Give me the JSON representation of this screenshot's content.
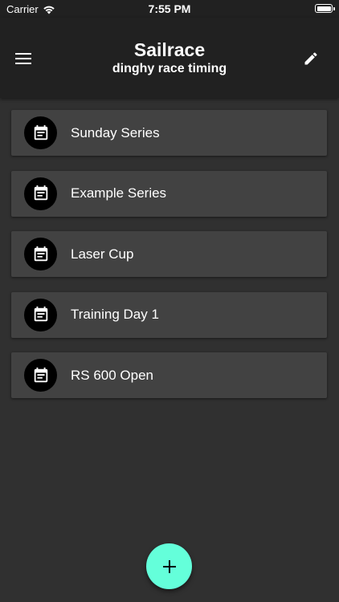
{
  "status_bar": {
    "carrier": "Carrier",
    "time": "7:55 PM"
  },
  "app_bar": {
    "title": "Sailrace",
    "subtitle": "dinghy race timing",
    "menu_icon": "menu-icon",
    "edit_icon": "pencil-icon"
  },
  "series": [
    {
      "label": "Sunday Series",
      "icon": "calendar-note-icon"
    },
    {
      "label": "Example Series",
      "icon": "calendar-note-icon"
    },
    {
      "label": "Laser Cup",
      "icon": "calendar-note-icon"
    },
    {
      "label": "Training Day 1",
      "icon": "calendar-note-icon"
    },
    {
      "label": "RS 600 Open",
      "icon": "calendar-note-icon"
    }
  ],
  "fab": {
    "icon": "plus-icon",
    "color": "#64ffda"
  },
  "colors": {
    "background": "#303030",
    "app_bar": "#212121",
    "card": "#424242",
    "accent": "#64ffda"
  }
}
